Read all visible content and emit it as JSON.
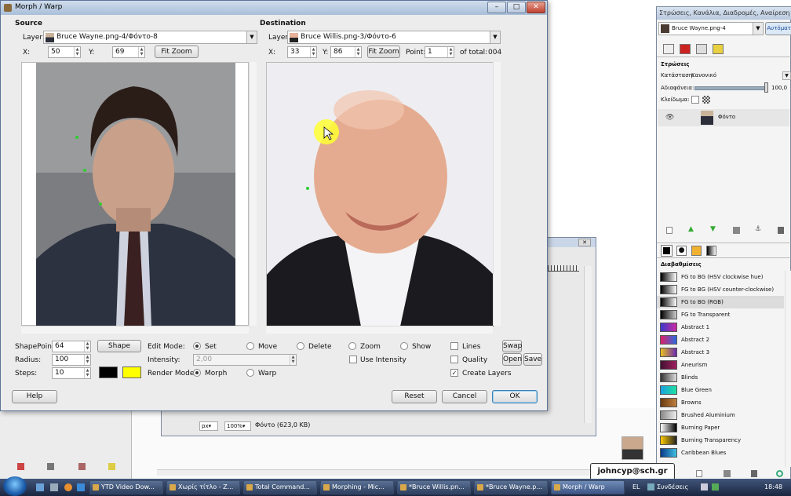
{
  "dialog": {
    "title": "Morph / Warp",
    "source": {
      "section_label": "Source",
      "layer_label": "Layer:",
      "layer_value": "Bruce Wayne.png-4/Φόντο-8",
      "x_label": "X:",
      "x_value": "50",
      "y_label": "Y:",
      "y_value": "69",
      "fit_zoom": "Fit Zoom"
    },
    "destination": {
      "section_label": "Destination",
      "layer_label": "Layer:",
      "layer_value": "Bruce Willis.png-3/Φόντο-6",
      "x_label": "X:",
      "x_value": "33",
      "y_label": "Y:",
      "y_value": "86",
      "fit_zoom": "Fit Zoom",
      "point_label": "Point:",
      "point_value": "1",
      "of_total_label": "of total:",
      "total_value": "004"
    },
    "shapepoints_label": "ShapePoints:",
    "shapepoints_value": "64",
    "shape_button": "Shape",
    "radius_label": "Radius:",
    "radius_value": "100",
    "steps_label": "Steps:",
    "steps_value": "10",
    "fg_color": "#000000",
    "bg_color": "#ffff00",
    "edit_mode_label": "Edit Mode:",
    "edit_modes": [
      "Set",
      "Move",
      "Delete",
      "Zoom",
      "Show"
    ],
    "edit_mode_selected": "Set",
    "intensity_label": "Intensity:",
    "intensity_value": "2,00",
    "use_intensity": "Use Intensity",
    "render_mode_label": "Render Mode:",
    "render_modes": [
      "Morph",
      "Warp"
    ],
    "render_mode_selected": "Morph",
    "lines": "Lines",
    "quality": "Quality",
    "create_layers": "Create Layers",
    "swap": "Swap",
    "open": "Open",
    "save": "Save",
    "help": "Help",
    "reset": "Reset",
    "cancel": "Cancel",
    "ok": "OK"
  },
  "behind_window": {
    "zoom_unit": "px▾",
    "zoom": "100%▾",
    "status": "Φόντο (623,0 KB)"
  },
  "layers_panel": {
    "title": "Στρώσεις, Κανάλια, Διαδρομές, Αναίρεση - Πινέ...",
    "image_combo": "Bruce Wayne.png-4",
    "auto_button": "Αυτόματα",
    "layers_heading": "Στρώσεις",
    "mode_label": "Κατάσταση:",
    "mode_value": "Κανονικό",
    "opacity_label": "Αδιαφάνεια:",
    "opacity_value": "100,0",
    "lock_label": "Κλείδωμα:",
    "layer_name": "Φόντο",
    "gradients_heading": "Διαβαθμίσεις",
    "gradients": [
      {
        "name": "FG to BG (HSV clockwise hue)",
        "colors": [
          "#000000",
          "#ffffff"
        ]
      },
      {
        "name": "FG to BG (HSV counter-clockwise)",
        "colors": [
          "#000000",
          "#ffffff"
        ]
      },
      {
        "name": "FG to BG (RGB)",
        "colors": [
          "#000000",
          "#ffffff"
        ]
      },
      {
        "name": "FG to Transparent",
        "colors": [
          "#000000",
          "#cccccc"
        ]
      },
      {
        "name": "Abstract 1",
        "colors": [
          "#3a3acc",
          "#cc2aa0"
        ]
      },
      {
        "name": "Abstract 2",
        "colors": [
          "#e0206a",
          "#2a6ae0"
        ]
      },
      {
        "name": "Abstract 3",
        "colors": [
          "#e8c020",
          "#6a2ab0"
        ]
      },
      {
        "name": "Aneurism",
        "colors": [
          "#401030",
          "#a02060"
        ]
      },
      {
        "name": "Blinds",
        "colors": [
          "#333333",
          "#dddddd"
        ]
      },
      {
        "name": "Blue Green",
        "colors": [
          "#1aa0e0",
          "#20e0a0"
        ]
      },
      {
        "name": "Browns",
        "colors": [
          "#6a3a10",
          "#c08040"
        ]
      },
      {
        "name": "Brushed Aluminium",
        "colors": [
          "#888888",
          "#eeeeee"
        ]
      },
      {
        "name": "Burning Paper",
        "colors": [
          "#ffffff",
          "#000000"
        ]
      },
      {
        "name": "Burning Transparency",
        "colors": [
          "#ffcc00",
          "#222222"
        ]
      },
      {
        "name": "Caribbean Blues",
        "colors": [
          "#0a3a8a",
          "#40c0e0"
        ]
      }
    ]
  },
  "taskbar": {
    "items": [
      "YTD Video Dow...",
      "Χωρίς τίτλο - Z...",
      "Total Command...",
      "Morphing - Mic...",
      "*Bruce Willis.pn...",
      "*Bruce Wayne.p...",
      "Morph / Warp"
    ],
    "lang": "EL",
    "tray_label": "Συνδέσεις",
    "clock": "18:48"
  },
  "email_badge": "johncyp@sch.gr"
}
